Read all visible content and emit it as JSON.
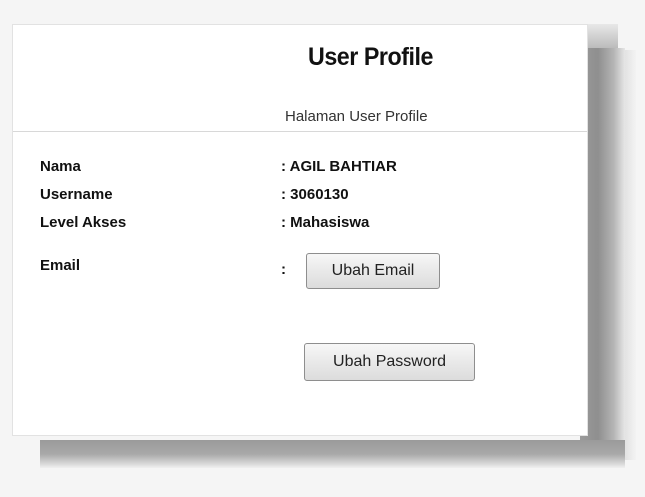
{
  "profile": {
    "title": "User Profile",
    "subtitle": "Halaman User Profile",
    "fields": [
      {
        "label": "Nama",
        "value": ": AGIL BAHTIAR"
      },
      {
        "label": "Username",
        "value": ": 3060130"
      },
      {
        "label": "Level Akses",
        "value": ": Mahasiswa"
      },
      {
        "label": "Email",
        "value": ":"
      }
    ],
    "change_email_label": "Ubah Email",
    "change_password_label": "Ubah Password"
  }
}
